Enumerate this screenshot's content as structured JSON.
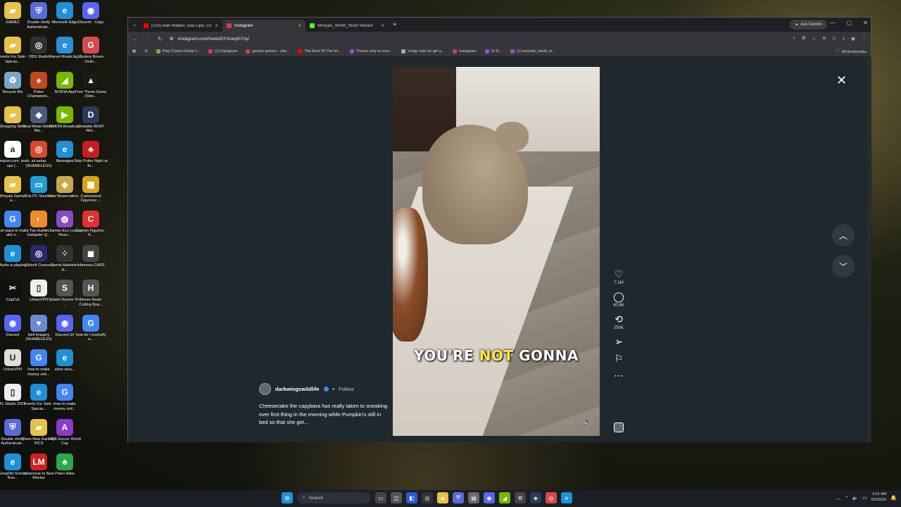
{
  "desktop_icons": [
    {
      "label": "GAMEZ",
      "color": "#e8c14a",
      "glyph": "▰"
    },
    {
      "label": "Double Verify Authenticati...",
      "color": "#5a6bd8",
      "glyph": "⛨"
    },
    {
      "label": "Microsoft Edge",
      "color": "#1f8fd6",
      "glyph": "e"
    },
    {
      "label": "Discord - Copy",
      "color": "#5865f2",
      "glyph": "◉"
    },
    {
      "label": "Inverts For Sale - Specia...",
      "color": "#e8c14a",
      "glyph": "▰"
    },
    {
      "label": "OBS Studio",
      "color": "#302e31",
      "glyph": "◎"
    },
    {
      "label": "Marvel Rivals.bg...",
      "color": "#2a8fd6",
      "glyph": "e"
    },
    {
      "label": "Mystery Boxes Onlin...",
      "color": "#d64a4a",
      "glyph": "G"
    },
    {
      "label": "Recycle Bin",
      "color": "#7aa7c7",
      "glyph": "♻"
    },
    {
      "label": "Poker Champions...",
      "color": "#c24a1a",
      "glyph": "♠"
    },
    {
      "label": "NVIDIA App",
      "color": "#76b900",
      "glyph": "◢"
    },
    {
      "label": "Free Throw Game (Shin...",
      "color": "#1a1a1a",
      "glyph": "▲"
    },
    {
      "label": "Shopping Sites",
      "color": "#e8c14a",
      "glyph": "▰"
    },
    {
      "label": "Real Metal Hidden Bla...",
      "color": "#4a5a7a",
      "glyph": "◆"
    },
    {
      "label": "NVIDIA Broadcast",
      "color": "#76b900",
      "glyph": "▶"
    },
    {
      "label": "Unstable BOAT Wid...",
      "color": "#2a3a5a",
      "glyph": "D"
    },
    {
      "label": "Amazon.com: push ups (...",
      "color": "#ffffff",
      "glyph": "a"
    },
    {
      "label": "sd.setup (SHAMELESS)",
      "color": "#d64a2a",
      "glyph": "◎"
    },
    {
      "label": "Messages",
      "color": "#1f8fd6",
      "glyph": "e"
    },
    {
      "label": "Strip Poker Night at th...",
      "color": "#c81e1e",
      "glyph": "♣"
    },
    {
      "label": "Wroyals Games a...",
      "color": "#e8c14a",
      "glyph": "▰"
    },
    {
      "label": "This PC Shortcut",
      "color": "#1f9fd6",
      "glyph": "▭"
    },
    {
      "label": "New Reservation...",
      "color": "#c8a84a",
      "glyph": "◈"
    },
    {
      "label": "Customized Figurines ...",
      "color": "#d6a61a",
      "glyph": "▦"
    },
    {
      "label": "best ways to make alot o...",
      "color": "#4285f4",
      "glyph": "G"
    },
    {
      "label": "Top Hustle Gangster Q...",
      "color": "#f08a2a",
      "glyph": "◐"
    },
    {
      "label": "Ulamen Eco Luxury Reso...",
      "color": "#8a4ac8",
      "glyph": "◍"
    },
    {
      "label": "Custom Figurine - S...",
      "color": "#e03030",
      "glyph": "C"
    },
    {
      "label": "Audio is playing",
      "color": "#1f8fd6",
      "glyph": "e"
    },
    {
      "label": "Ubisoft Connect",
      "color": "#2a2a6a",
      "glyph": "◎"
    },
    {
      "label": "Sports Markets - R...",
      "color": "#333333",
      "glyph": "⁘"
    },
    {
      "label": "Infamous CARS",
      "color": "#444444",
      "glyph": "◼"
    },
    {
      "label": "CapCut",
      "color": "#111111",
      "glyph": "✂"
    },
    {
      "label": "UrbanVPN",
      "color": "#eeeeee",
      "glyph": "▯"
    },
    {
      "label": "Splash Runner Pro ...",
      "color": "#555555",
      "glyph": "S"
    },
    {
      "label": "Honor Resin Cutting Boa...",
      "color": "#555555",
      "glyph": "H"
    },
    {
      "label": "Discord",
      "color": "#5865f2",
      "glyph": "◉"
    },
    {
      "label": "Hell Imagery (SHAMELESS)",
      "color": "#6a8ad6",
      "glyph": "♥"
    },
    {
      "label": "Discord (2)",
      "color": "#5865f2",
      "glyph": "◉"
    },
    {
      "label": "how do I mumsify a...",
      "color": "#4285f4",
      "glyph": "G"
    },
    {
      "label": "UrbanVPN",
      "color": "#dddddd",
      "glyph": "U"
    },
    {
      "label": "how to make money onli...",
      "color": "#4285f4",
      "glyph": "G"
    },
    {
      "label": "store stea...",
      "color": "#1f8fd6",
      "glyph": "e"
    },
    {
      "label": "",
      "color": "transparent",
      "glyph": ""
    },
    {
      "label": "FL Studio 2025",
      "color": "#eeeeee",
      "glyph": "▯"
    },
    {
      "label": "Inverts For Sale - Specia...",
      "color": "#1f8fd6",
      "glyph": "e"
    },
    {
      "label": "how to make money onli...",
      "color": "#4285f4",
      "glyph": "G"
    },
    {
      "label": "",
      "color": "transparent",
      "glyph": ""
    },
    {
      "label": "Double Verify Authenticati...",
      "color": "#5a6bd8",
      "glyph": "⛨"
    },
    {
      "label": "Dans New Gaming PICS",
      "color": "#e8c14a",
      "glyph": "▰"
    },
    {
      "label": "FIFA Soccer World Cup",
      "color": "#8a3ac8",
      "glyph": "A"
    },
    {
      "label": "",
      "color": "transparent",
      "glyph": ""
    },
    {
      "label": "GregOld School Run...",
      "color": "#1f8fd6",
      "glyph": "e"
    },
    {
      "label": "lookmovie to New Movies",
      "color": "#d02020",
      "glyph": "LM"
    },
    {
      "label": "Poker Atlas",
      "color": "#2aa84a",
      "glyph": "♣"
    }
  ],
  "browser": {
    "tabs": [
      {
        "title": "(103) Alan Walker, Dua Lipa, Co...",
        "color": "#ff0000",
        "active": false
      },
      {
        "title": "Instagram",
        "color": "#e1306c",
        "active": true
      },
      {
        "title": "Wroyals_World_Woof Stream",
        "color": "#53fc18",
        "active": false
      }
    ],
    "new_tab": "+",
    "ask_gemini": "Ask Gemini",
    "url": "instagram.com/reels/DYXskqIh7ny/",
    "bookmarks": [
      {
        "label": "Play Chess Online f...",
        "color": "#7fa650"
      },
      {
        "label": "(1) Instagram",
        "color": "#e1306c"
      },
      {
        "label": "games games - sha...",
        "color": "#d04040"
      },
      {
        "label": "The Best Of The Int...",
        "color": "#ff0000"
      },
      {
        "label": "Theres only so muc...",
        "color": "#a04ad0"
      },
      {
        "label": "clingy man on girl a...",
        "color": "#aaaaaa"
      },
      {
        "label": "Instagram",
        "color": "#e1306c"
      },
      {
        "label": "SI D...",
        "color": "#a04ad0"
      },
      {
        "label": "(1) wroyals_world_w...",
        "color": "#a04ad0"
      }
    ],
    "all_bookmarks": "All Bookmarks"
  },
  "reel": {
    "caption_pre": "YOU'RE ",
    "caption_hl": "NOT",
    "caption_post": " GONNA",
    "username": "darkwingswildlife",
    "follow": "Follow",
    "description": "Cheesecake the capybara has really taken to sneaking over first thing in the morning while Pumpkin's still in bed so that she get...",
    "likes": "7.1M",
    "comments": "40.6K",
    "reposts": "250K"
  },
  "taskbar": {
    "search_placeholder": "Search",
    "time": "4:31 AM",
    "date": "8/2/2026"
  }
}
